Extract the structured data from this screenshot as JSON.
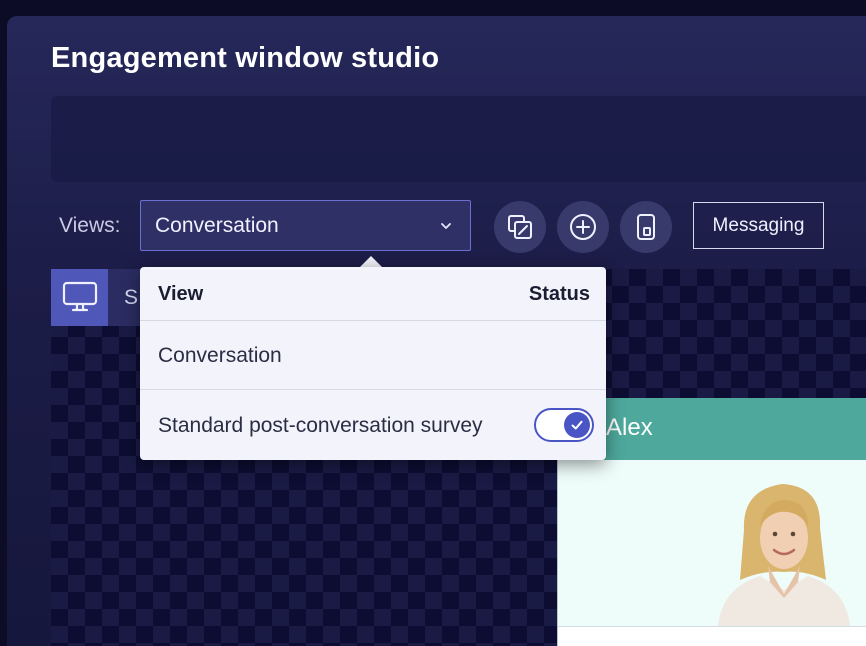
{
  "header": {
    "title": "Engagement window studio"
  },
  "toolbar": {
    "views_label": "Views:",
    "selected_view": "Conversation",
    "messaging_label": "Messaging",
    "buttons": {
      "copy_edit": "copy-edit-icon",
      "add": "plus-circle-icon",
      "device": "tablet-icon"
    }
  },
  "canvas": {
    "tab_label_partial": "S",
    "active_tab_icon": "desktop-monitor-icon"
  },
  "dropdown": {
    "col_view": "View",
    "col_status": "Status",
    "rows": [
      {
        "label": "Conversation"
      },
      {
        "label": "Standard post-conversation survey",
        "status_enabled": true
      }
    ]
  },
  "preview": {
    "agent_name": "Alex",
    "header_color": "#4ea89c"
  },
  "colors": {
    "accent": "#4a55c5",
    "background": "#16173c"
  }
}
